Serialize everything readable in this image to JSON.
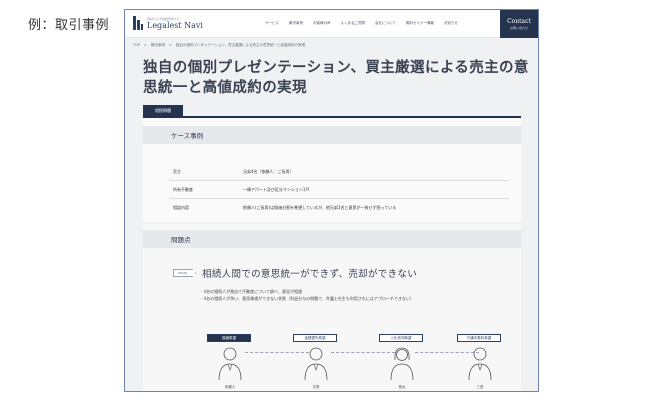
{
  "caption": "例：取引事例",
  "header": {
    "logo_tagline": "選ばれる不動産売却ナビ",
    "logo_name": "Legalest Navi",
    "nav": [
      "サービス",
      "解決事例",
      "お客様の声",
      "よくあるご質問",
      "会社について",
      "無料セミナー情報",
      "お知らせ"
    ],
    "contact_label": "Contact",
    "contact_sub": "お問い合わせ"
  },
  "breadcrumb": [
    "TOP",
    ">",
    "解決事例",
    ">",
    "独自の個別プレゼンテーション、買主厳選による売主の意思統一と高値成約の実現"
  ],
  "page_title": "独自の個別プレゼンテーション、買主厳選による売主の意思統一と高値成約の実現",
  "tab_label": "相続問題",
  "case": {
    "heading": "ケース事例",
    "rows": [
      {
        "key": "売主",
        "value": "兄弟4名（依頼人：ご長男）"
      },
      {
        "key": "所有不動産",
        "value": "一棟アパート及び区分マンション1戸"
      },
      {
        "key": "相談内容",
        "value": "依頼人(ご長男)は換価分割を希望しているが、他兄弟3名と意思が一致せず困っている"
      }
    ]
  },
  "problem": {
    "heading": "問題点",
    "badge": "Issue",
    "issue_title": "相続人間での意思統一ができず、売却ができない",
    "bullets": [
      "4名の相続人が独自で不動産について調べ、意見が相違",
      "4名の相続人が争い、意思疎通ができない状態（利益分与の問題で、弁護士先生も利用されにはアプローチできない）"
    ],
    "persons": [
      {
        "label": "換価希望",
        "name": "依頼人",
        "active": true
      },
      {
        "label": "金銭優先希望",
        "name": "次男",
        "active": false
      },
      {
        "label": "入札売却希望",
        "name": "長女",
        "active": false
      },
      {
        "label": "万通手数料希望",
        "name": "三男",
        "active": false
      }
    ]
  },
  "colors": {
    "navy": "#24344f",
    "accent_border": "#6f84b6",
    "panel": "#f0f1f3"
  }
}
